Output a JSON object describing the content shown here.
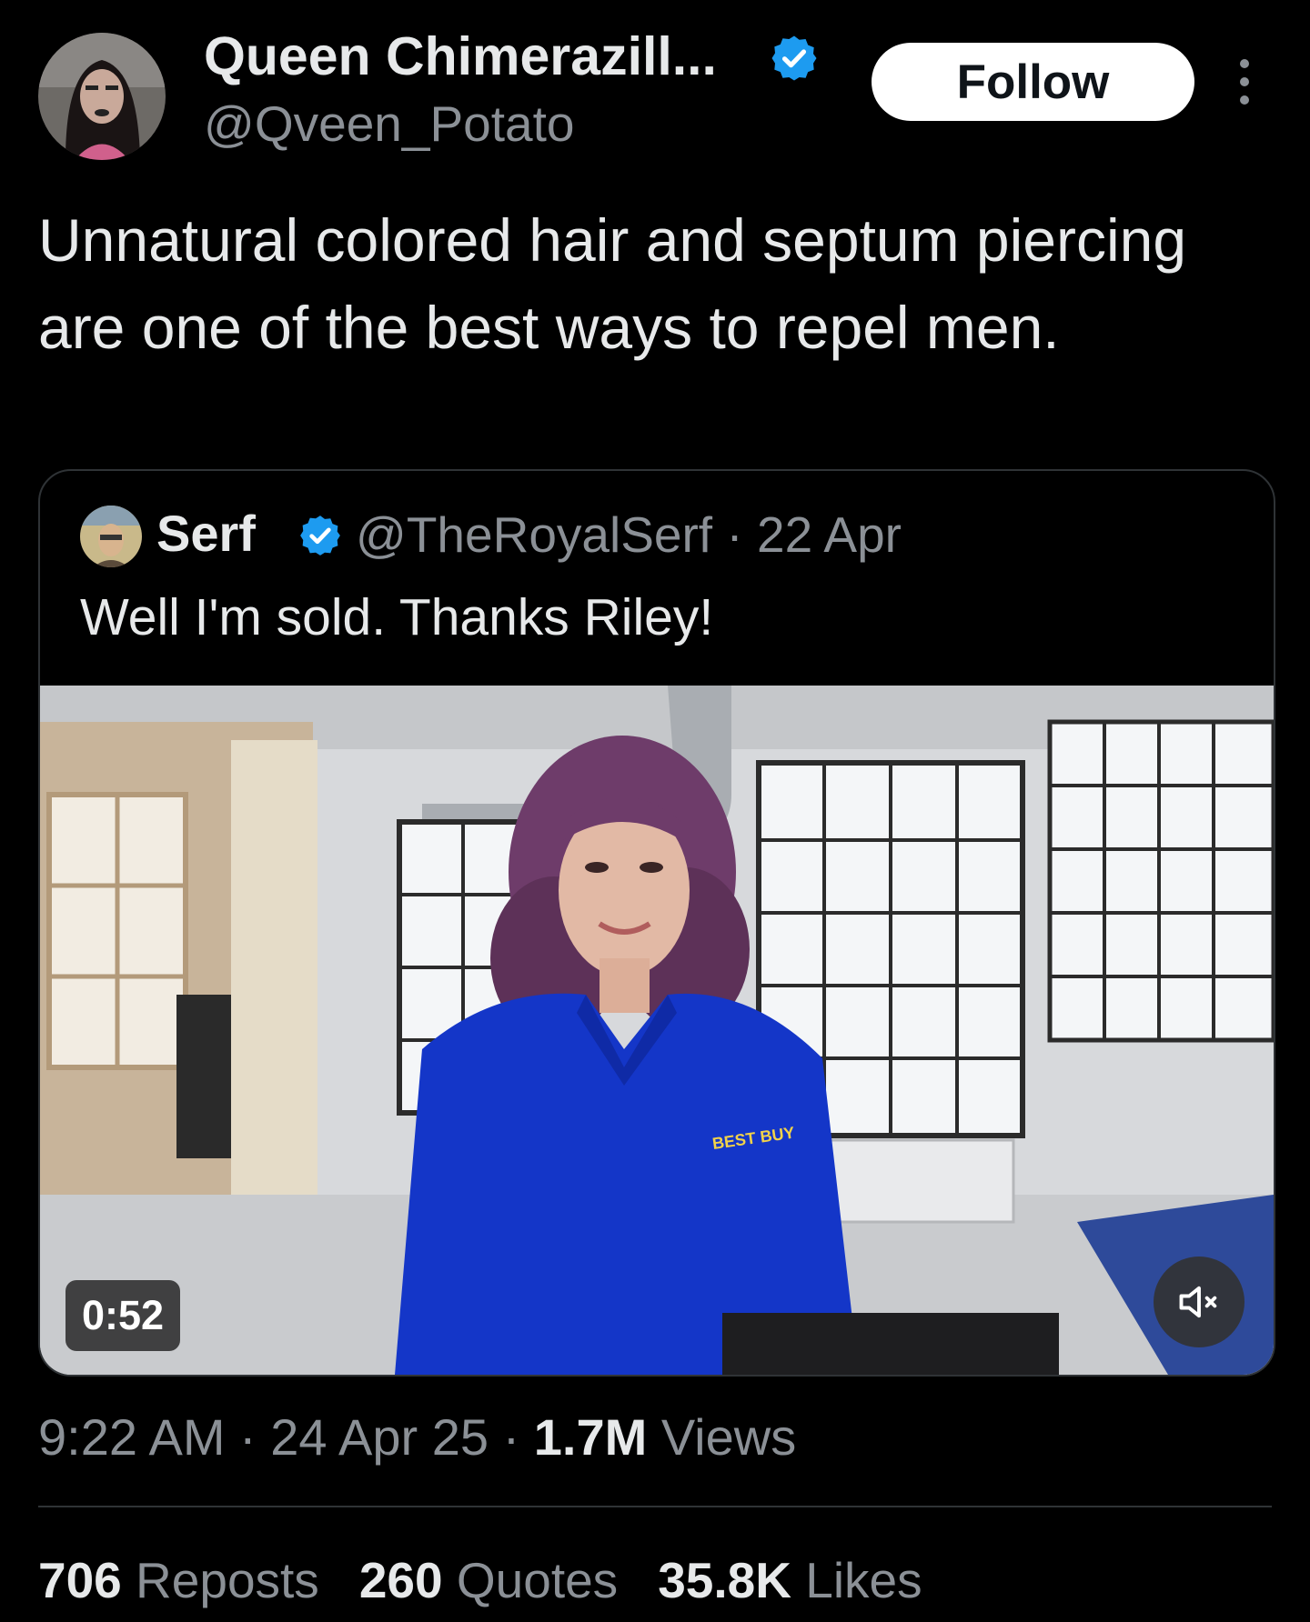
{
  "tweet": {
    "display_name": "Queen Chimerazill...",
    "handle": "@Qveen_Potato",
    "follow_label": "Follow",
    "text": "Unnatural colored hair and septum piercing are one of the best ways to repel men.",
    "time": "9:22 AM",
    "date": "24 Apr 25",
    "views_count": "1.7M",
    "views_label": "Views",
    "sep": "·"
  },
  "quote": {
    "display_name": "Serf",
    "handle": "@TheRoyalSerf",
    "date": "22 Apr",
    "sep": "·",
    "text": "Well I'm sold. Thanks Riley!",
    "video_duration": "0:52",
    "shirt_logo": "BEST BUY"
  },
  "stats": {
    "reposts_count": "706",
    "reposts_label": "Reposts",
    "quotes_count": "260",
    "quotes_label": "Quotes",
    "likes_count": "35.8K",
    "likes_label": "Likes"
  },
  "colors": {
    "background": "#000000",
    "text": "#e7e9ea",
    "secondary_text": "#8b9096",
    "verified": "#1d9bf0",
    "shirt": "#1436c8"
  },
  "icons": [
    "verified-badge-icon",
    "more-options-icon",
    "mute-icon"
  ]
}
